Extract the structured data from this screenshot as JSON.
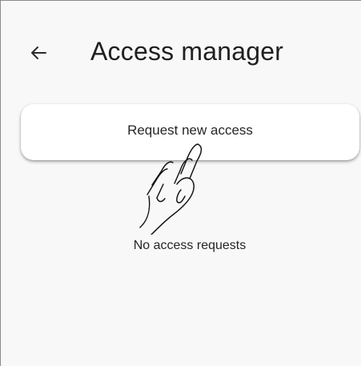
{
  "app": {
    "title": "Access manager"
  },
  "header": {
    "back_icon": "back-arrow-icon",
    "title": "Access manager"
  },
  "main": {
    "request_button": {
      "label": "Request new access"
    },
    "gesture_icon": "tap-hand-icon",
    "empty_state": {
      "text": "No access requests"
    }
  },
  "colors": {
    "background": "#f8f8f8",
    "button_background": "#ffffff",
    "text": "#1f1f1f",
    "border": "#8a8a8a"
  }
}
